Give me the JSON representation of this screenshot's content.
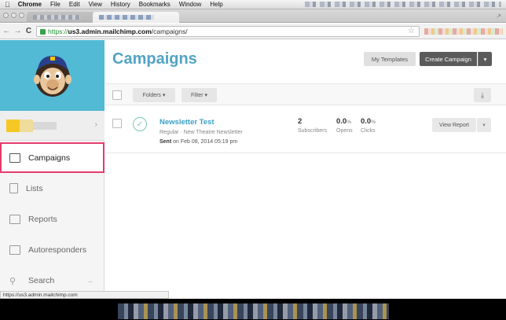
{
  "menubar": {
    "items": [
      "Chrome",
      "File",
      "Edit",
      "View",
      "History",
      "Bookmarks",
      "Window",
      "Help"
    ]
  },
  "address_bar": {
    "secure_scheme": "https://",
    "host": "us3.admin.mailchimp.com",
    "path": "/campaigns/"
  },
  "sidebar": {
    "items": [
      {
        "label": "Campaigns",
        "icon": "campaigns-icon",
        "active": true
      },
      {
        "label": "Lists",
        "icon": "lists-icon",
        "active": false
      },
      {
        "label": "Reports",
        "icon": "reports-icon",
        "active": false
      },
      {
        "label": "Autoresponders",
        "icon": "autoresponders-icon",
        "active": false
      },
      {
        "label": "Search",
        "icon": "search-icon",
        "active": false
      }
    ],
    "collapse_glyph": "←"
  },
  "header": {
    "title": "Campaigns",
    "my_templates_label": "My Templates",
    "create_campaign_label": "Create Campaign",
    "create_campaign_arrow": "▾"
  },
  "filters": {
    "folders_label": "Folders ▾",
    "filter_label": "Filter ▾",
    "download_glyph": "⤓"
  },
  "campaigns": [
    {
      "title": "Newsletter Test",
      "subtitle": "Regular · New Theatre Newsletter",
      "sent_label": "Sent",
      "sent_date": "on Feb 08, 2014 05:19 pm",
      "subscribers": "2",
      "subscribers_label": "Subscribers",
      "opens": "0.0",
      "opens_label": "Opens",
      "clicks": "0.0",
      "clicks_label": "Clicks",
      "percent_sign": "%",
      "report_label": "View Report",
      "report_arrow": "▾"
    }
  ],
  "status_url": "https://us3.admin.mailchimp.com",
  "colors": {
    "brand_blue": "#52bad5",
    "title_blue": "#52a3c4",
    "link_blue": "#3b9fc6",
    "highlight_pink": "#e63b6c",
    "sent_green": "#7cc9a8",
    "dark_button": "#5b5b5b"
  }
}
